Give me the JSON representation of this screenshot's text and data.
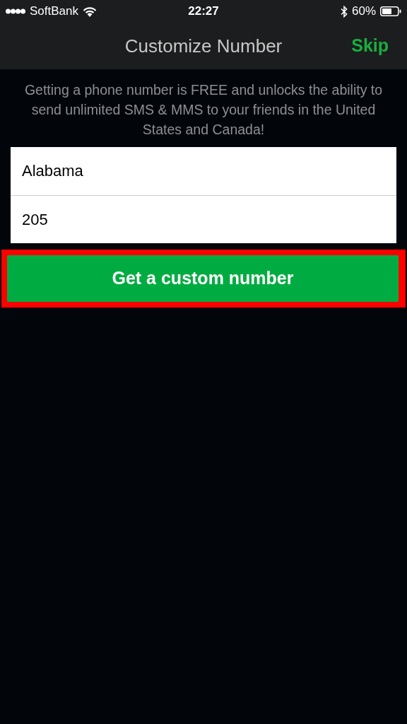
{
  "status_bar": {
    "carrier": "SoftBank",
    "time": "22:27",
    "battery": "60%"
  },
  "nav": {
    "title": "Customize Number",
    "action": "Skip"
  },
  "intro": "Getting a phone number is FREE and unlocks the ability to send unlimited SMS & MMS to your friends in the United States and Canada!",
  "fields": [
    {
      "value": "Alabama"
    },
    {
      "value": "205"
    }
  ],
  "button": {
    "label": "Get a custom number",
    "highlighted": true
  }
}
